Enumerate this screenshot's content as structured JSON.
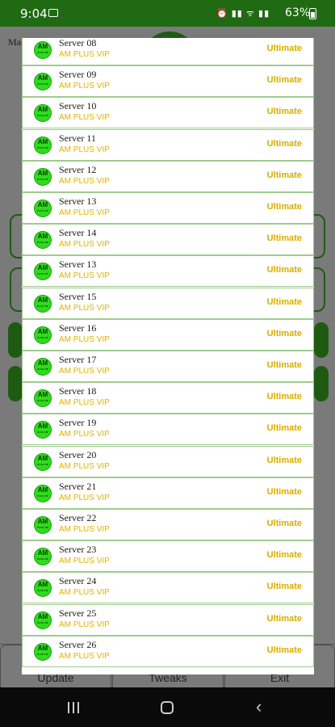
{
  "status_bar": {
    "time": "9:04",
    "icons_text": "⏰ ▮▮ ᯤ ▮▮",
    "battery": "63%"
  },
  "background_app": {
    "title": "Master Full Ma",
    "bottom_buttons": [
      "Update",
      "Tweaks",
      "Exit"
    ]
  },
  "colors": {
    "status_bar": "#1f6a12",
    "accent_green": "#2fdc1d",
    "row_border": "#9ecb8e",
    "tier_yellow": "#d8ad00"
  },
  "servers": [
    {
      "name": "Server 08",
      "subtitle": "AM PLUS VIP",
      "tier": "Ultimate"
    },
    {
      "name": "Server 09",
      "subtitle": "AM PLUS VIP",
      "tier": "Ultimate"
    },
    {
      "name": "Server 10",
      "subtitle": "AM PLUS VIP",
      "tier": "Ultimate"
    },
    {
      "name": "Server 11",
      "subtitle": "AM PLUS VIP",
      "tier": "Ultimate"
    },
    {
      "name": "Server 12",
      "subtitle": "AM PLUS VIP",
      "tier": "Ultimate"
    },
    {
      "name": "Server 13",
      "subtitle": "AM PLUS VIP",
      "tier": "Ultimate"
    },
    {
      "name": "Server 14",
      "subtitle": "AM PLUS VIP",
      "tier": "Ultimate"
    },
    {
      "name": "Server 13",
      "subtitle": "AM PLUS VIP",
      "tier": "Ultimate"
    },
    {
      "name": "Server 15",
      "subtitle": "AM PLUS VIP",
      "tier": "Ultimate"
    },
    {
      "name": "Server 16",
      "subtitle": "AM PLUS VIP",
      "tier": "Ultimate"
    },
    {
      "name": "Server 17",
      "subtitle": "AM PLUS VIP",
      "tier": "Ultimate"
    },
    {
      "name": "Server 18",
      "subtitle": "AM PLUS VIP",
      "tier": "Ultimate"
    },
    {
      "name": "Server 19",
      "subtitle": "AM PLUS VIP",
      "tier": "Ultimate"
    },
    {
      "name": "Server 20",
      "subtitle": "AM PLUS VIP",
      "tier": "Ultimate"
    },
    {
      "name": "Server 21",
      "subtitle": "AM PLUS VIP",
      "tier": "Ultimate"
    },
    {
      "name": "Server 22",
      "subtitle": "AM PLUS VIP",
      "tier": "Ultimate"
    },
    {
      "name": "Server 23",
      "subtitle": "AM PLUS VIP",
      "tier": "Ultimate"
    },
    {
      "name": "Server 24",
      "subtitle": "AM PLUS VIP",
      "tier": "Ultimate"
    },
    {
      "name": "Server 25",
      "subtitle": "AM PLUS VIP",
      "tier": "Ultimate"
    },
    {
      "name": "Server 26",
      "subtitle": "AM PLUS VIP",
      "tier": "Ultimate"
    }
  ],
  "logo_text": "AM",
  "logo_subtext": "PLUS VIP"
}
